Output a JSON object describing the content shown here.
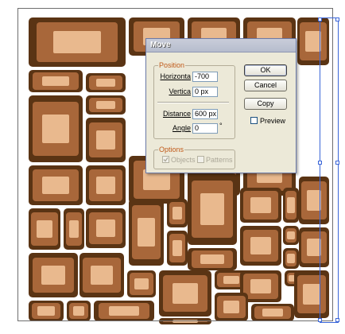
{
  "dialog": {
    "title": "Move",
    "position_group": {
      "label": "Position",
      "horizontal_label": "Horizonta",
      "horizontal_value": "-700",
      "vertical_label": "Vertica",
      "vertical_value": "0 px",
      "distance_label": "Distance",
      "distance_value": "600 px",
      "angle_label": "Angle",
      "angle_value": "0",
      "angle_unit": "°"
    },
    "options_group": {
      "label": "Options",
      "objects_label": "Objects",
      "objects_checked": true,
      "patterns_label": "Patterns",
      "patterns_checked": false
    },
    "buttons": {
      "ok": "OK",
      "cancel": "Cancel",
      "copy": "Copy"
    },
    "preview_label": "Preview",
    "preview_checked": false
  },
  "colors": {
    "tile_dark": "#5a3414",
    "tile_mid": "#a8673a",
    "tile_light": "#e9b98e",
    "selection": "#3b66d8"
  }
}
